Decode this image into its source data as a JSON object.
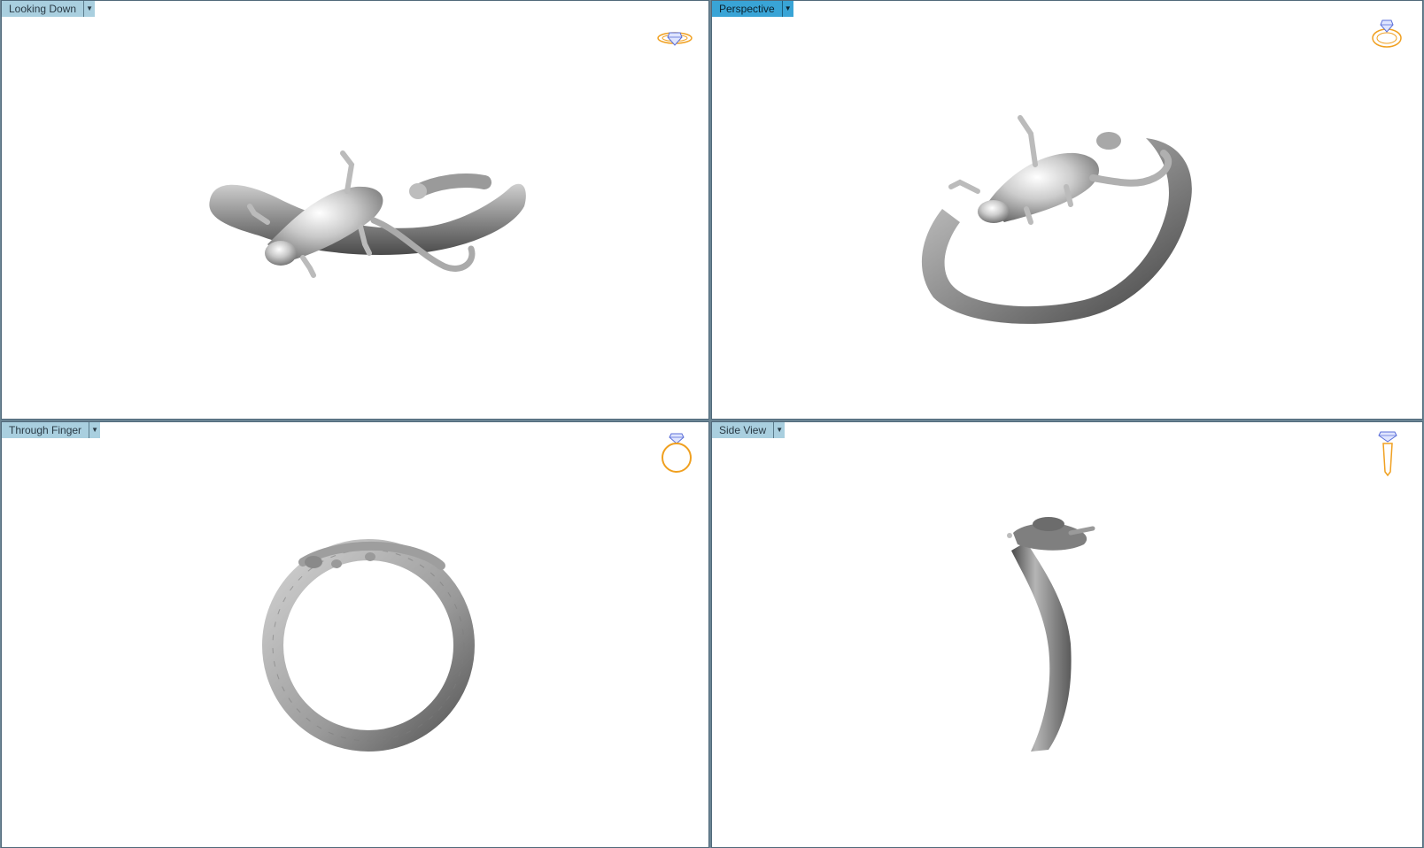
{
  "viewports": {
    "top_left": {
      "label": "Looking Down",
      "active": false
    },
    "top_right": {
      "label": "Perspective",
      "active": true
    },
    "bottom_left": {
      "label": "Through Finger",
      "active": false
    },
    "bottom_right": {
      "label": "Side View",
      "active": false
    }
  },
  "icons": {
    "dropdown": "chevron-down-icon",
    "view_cube": "ring-orientation-icon"
  },
  "colors": {
    "tab_inactive": "#a9cfdf",
    "tab_active": "#39a4d6",
    "ring_icon_band": "#f0a020",
    "ring_icon_gem": "#5b6fd8"
  }
}
